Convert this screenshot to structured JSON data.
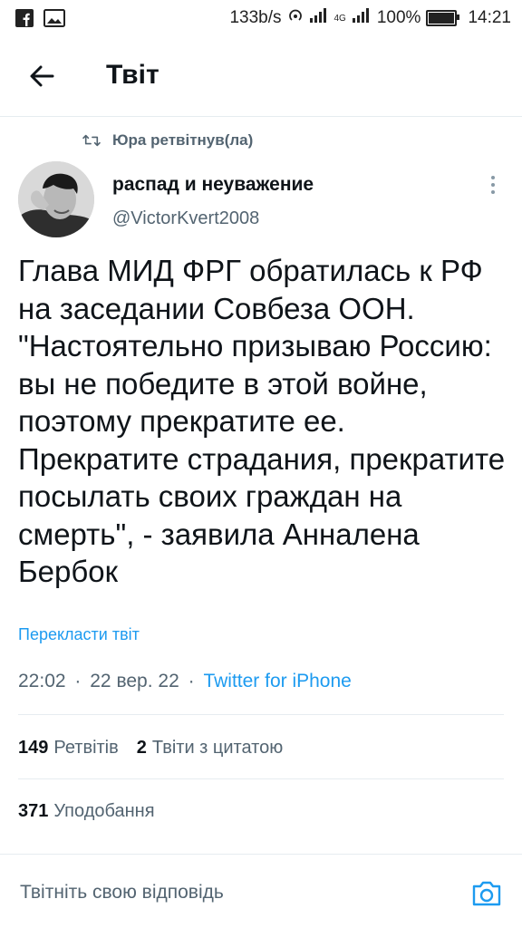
{
  "status_bar": {
    "net_speed": "133b/s",
    "network": "4G",
    "battery": "100%",
    "time": "14:21"
  },
  "header": {
    "title": "Твіт",
    "back_icon": "arrow-left-icon"
  },
  "retweet": {
    "text": "Юра ретвітнув(ла)",
    "icon": "retweet-icon"
  },
  "author": {
    "name": "распад и неуважение",
    "handle": "@VictorKvert2008"
  },
  "tweet": {
    "text": "Глава МИД ФРГ обратилась к РФ на заседании Совбеза ООН. \"Настоятельно призываю Россию: вы не победите в этой войне, поэтому прекратите ее. Прекратите страдания, прекратите посылать своих граждан на смерть\", - заявила Анналена Бербок",
    "translate_label": "Перекласти твіт",
    "time": "22:02",
    "date": "22 вер. 22",
    "source": "Twitter for iPhone",
    "separator": "·"
  },
  "stats": {
    "retweets_count": "149",
    "retweets_label": "Ретвітів",
    "quotes_count": "2",
    "quotes_label": "Твіти з цитатою",
    "likes_count": "371",
    "likes_label": "Уподобання"
  },
  "reply": {
    "placeholder": "Твітніть свою відповідь",
    "camera_icon": "camera-icon"
  },
  "colors": {
    "accent": "#1d9bf0",
    "secondary_text": "#536471",
    "primary_text": "#0f1419",
    "divider": "#e6ecf0"
  }
}
